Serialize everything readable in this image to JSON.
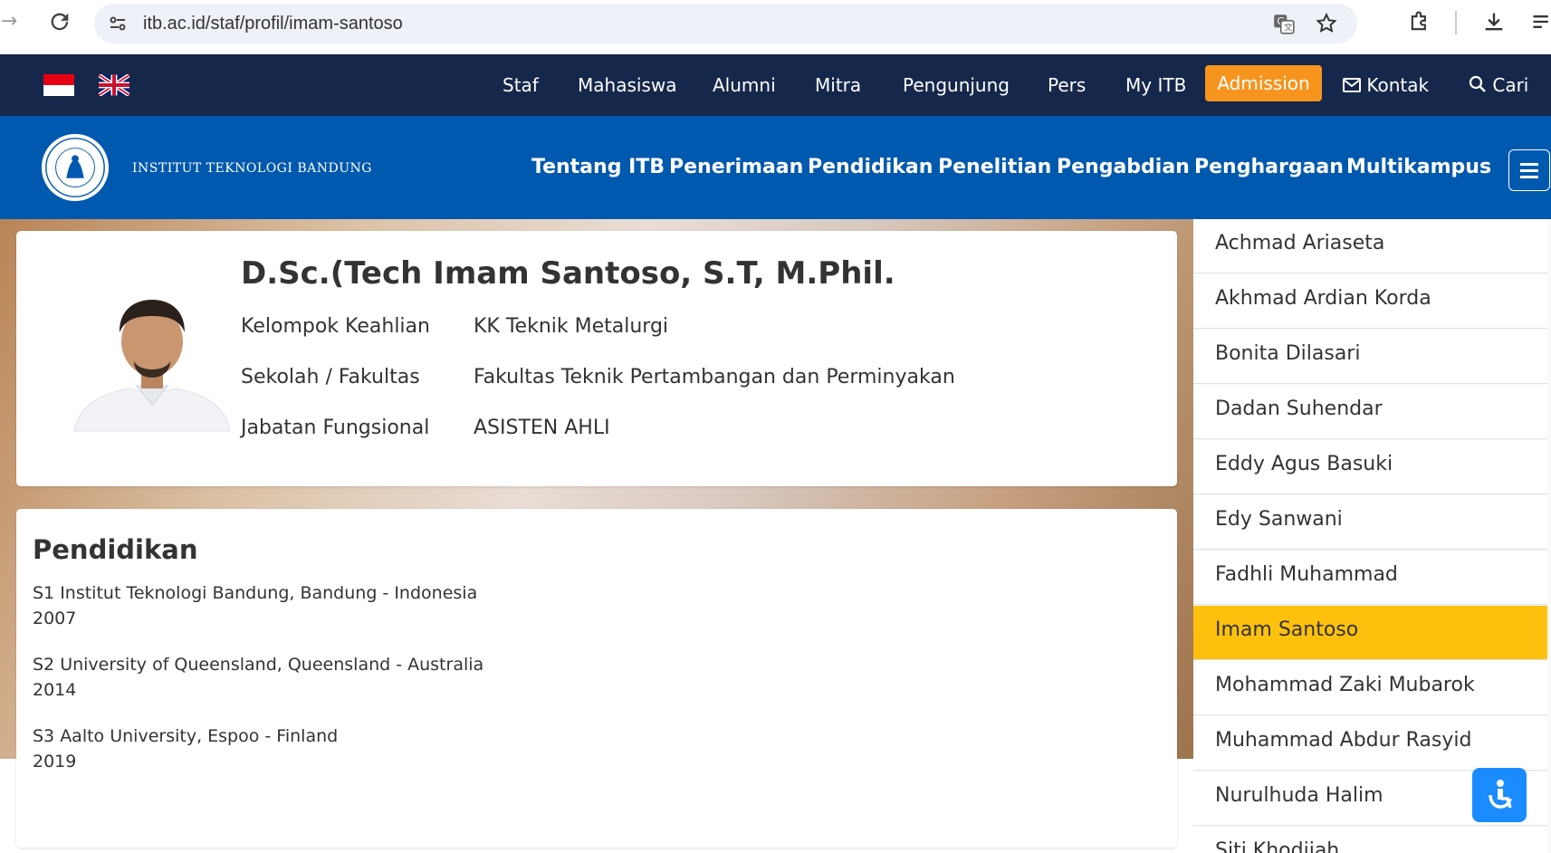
{
  "browser": {
    "url": "itb.ac.id/staf/profil/imam-santoso",
    "icons": [
      "back-arrow-icon",
      "reload-icon",
      "site-info-icon",
      "translate-icon",
      "bookmark-star-icon",
      "extensions-icon",
      "download-icon",
      "reading-list-icon"
    ]
  },
  "topnav": {
    "items": [
      "Staf",
      "Mahasiswa",
      "Alumni",
      "Mitra",
      "Pengunjung",
      "Pers",
      "My ITB"
    ],
    "admission": "Admission",
    "kontak": "Kontak",
    "cari": "Cari",
    "colors": {
      "background": "#15284b",
      "admission": "#f7941d"
    }
  },
  "mainnav": {
    "institution": "INSTITUT TEKNOLOGI BANDUNG",
    "items": [
      "Tentang ITB",
      "Penerimaan",
      "Pendidikan",
      "Penelitian",
      "Pengabdian",
      "Penghargaan",
      "Multikampus"
    ],
    "color": "#0059ae"
  },
  "profile": {
    "name": "D.Sc.(Tech Imam Santoso, S.T, M.Phil.",
    "fields": [
      {
        "label": "Kelompok Keahlian",
        "value": "KK Teknik Metalurgi"
      },
      {
        "label": "Sekolah / Fakultas",
        "value": "Fakultas Teknik Pertambangan dan Perminyakan"
      },
      {
        "label": "Jabatan Fungsional",
        "value": "ASISTEN AHLI"
      }
    ]
  },
  "education": {
    "title": "Pendidikan",
    "entries": [
      {
        "degree": "S1 Institut Teknologi Bandung, Bandung - Indonesia",
        "year": "2007"
      },
      {
        "degree": "S2 University of Queensland, Queensland - Australia",
        "year": "2014"
      },
      {
        "degree": "S3 Aalto University, Espoo - Finland",
        "year": "2019"
      }
    ]
  },
  "sidebar": {
    "active": "Imam Santoso",
    "active_color": "#fdc10d",
    "items": [
      "Achmad Ariaseta",
      "Akhmad Ardian Korda",
      "Bonita Dilasari",
      "Dadan Suhendar",
      "Eddy Agus Basuki",
      "Edy Sanwani",
      "Fadhli Muhammad",
      "Imam Santoso",
      "Mohammad Zaki Mubarok",
      "Muhammad Abdur Rasyid",
      "Nurulhuda Halim",
      "Siti Khodijah"
    ]
  }
}
